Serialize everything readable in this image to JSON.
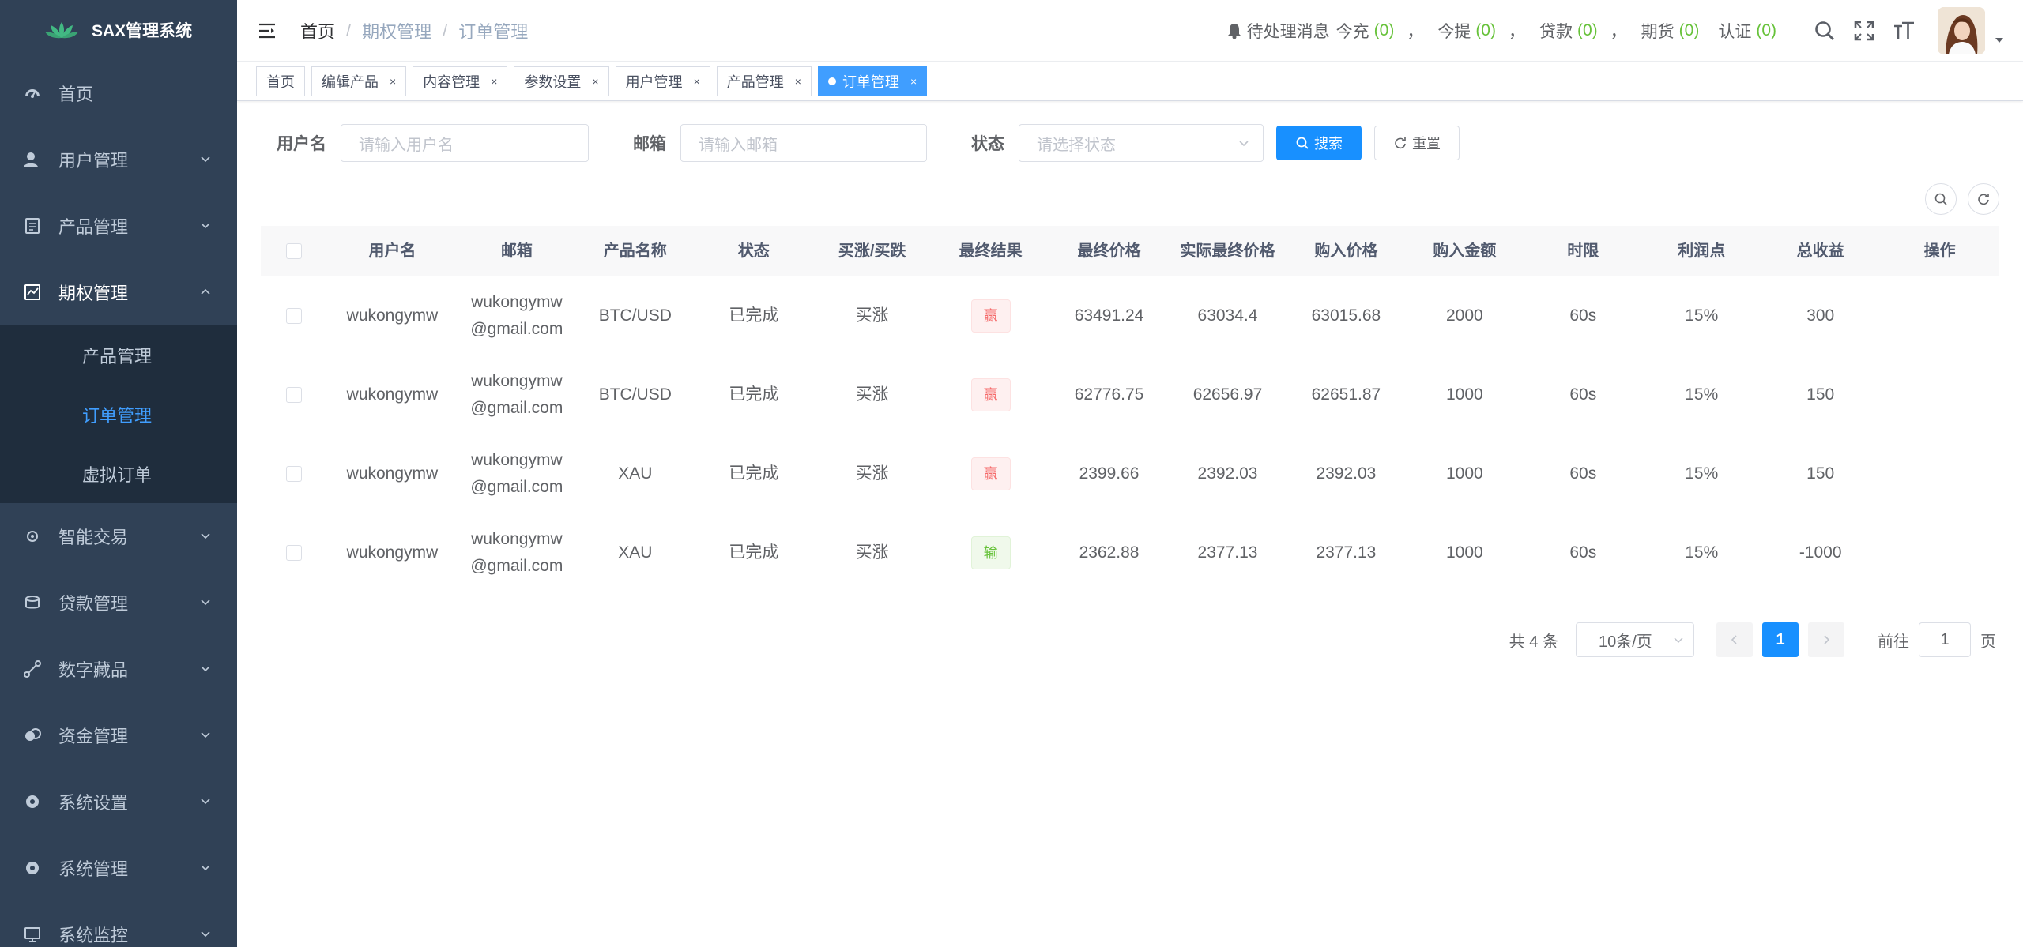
{
  "app": {
    "title": "SAX管理系统"
  },
  "sidebar": {
    "items": [
      {
        "label": "首页"
      },
      {
        "label": "用户管理"
      },
      {
        "label": "产品管理"
      },
      {
        "label": "期权管理"
      },
      {
        "label": "智能交易"
      },
      {
        "label": "贷款管理"
      },
      {
        "label": "数字藏品"
      },
      {
        "label": "资金管理"
      },
      {
        "label": "系统设置"
      },
      {
        "label": "系统管理"
      },
      {
        "label": "系统监控"
      }
    ],
    "submenu": [
      {
        "label": "产品管理"
      },
      {
        "label": "订单管理"
      },
      {
        "label": "虚拟订单"
      }
    ]
  },
  "breadcrumb": [
    "首页",
    "期权管理",
    "订单管理"
  ],
  "notice": {
    "prefix": "待处理消息",
    "items": [
      {
        "label": "今充",
        "value": "(0)"
      },
      {
        "label": "今提",
        "value": "(0)"
      },
      {
        "label": "贷款",
        "value": "(0)"
      },
      {
        "label": "期货",
        "value": "(0)"
      },
      {
        "label": "认证",
        "value": "(0)"
      }
    ],
    "sep": "，"
  },
  "tags": [
    "首页",
    "编辑产品",
    "内容管理",
    "参数设置",
    "用户管理",
    "产品管理",
    "订单管理"
  ],
  "tag_close": "×",
  "filter": {
    "username_label": "用户名",
    "username_placeholder": "请输入用户名",
    "email_label": "邮箱",
    "email_placeholder": "请输入邮箱",
    "status_label": "状态",
    "status_placeholder": "请选择状态",
    "search_button": "搜索",
    "reset_button": "重置"
  },
  "table": {
    "columns": [
      "用户名",
      "邮箱",
      "产品名称",
      "状态",
      "买涨/买跌",
      "最终结果",
      "最终价格",
      "实际最终价格",
      "购入价格",
      "购入金额",
      "时限",
      "利润点",
      "总收益",
      "操作"
    ],
    "rows": [
      {
        "user": "wukongymw",
        "email1": "wukongymw",
        "email2": "@gmail.com",
        "product": "BTC/USD",
        "status": "已完成",
        "direction": "买涨",
        "result": "赢",
        "result_type": "win",
        "final_price": "63491.24",
        "actual_price": "63034.4",
        "buy_price": "63015.68",
        "amount": "2000",
        "period": "60s",
        "profit": "15%",
        "total": "300"
      },
      {
        "user": "wukongymw",
        "email1": "wukongymw",
        "email2": "@gmail.com",
        "product": "BTC/USD",
        "status": "已完成",
        "direction": "买涨",
        "result": "赢",
        "result_type": "win",
        "final_price": "62776.75",
        "actual_price": "62656.97",
        "buy_price": "62651.87",
        "amount": "1000",
        "period": "60s",
        "profit": "15%",
        "total": "150"
      },
      {
        "user": "wukongymw",
        "email1": "wukongymw",
        "email2": "@gmail.com",
        "product": "XAU",
        "status": "已完成",
        "direction": "买涨",
        "result": "赢",
        "result_type": "win",
        "final_price": "2399.66",
        "actual_price": "2392.03",
        "buy_price": "2392.03",
        "amount": "1000",
        "period": "60s",
        "profit": "15%",
        "total": "150"
      },
      {
        "user": "wukongymw",
        "email1": "wukongymw",
        "email2": "@gmail.com",
        "product": "XAU",
        "status": "已完成",
        "direction": "买涨",
        "result": "输",
        "result_type": "lose",
        "final_price": "2362.88",
        "actual_price": "2377.13",
        "buy_price": "2377.13",
        "amount": "1000",
        "period": "60s",
        "profit": "15%",
        "total": "-1000"
      }
    ]
  },
  "pagination": {
    "total": "共 4 条",
    "page_size": "10条/页",
    "current": "1",
    "goto_label": "前往",
    "goto_value": "1",
    "page_unit": "页"
  }
}
